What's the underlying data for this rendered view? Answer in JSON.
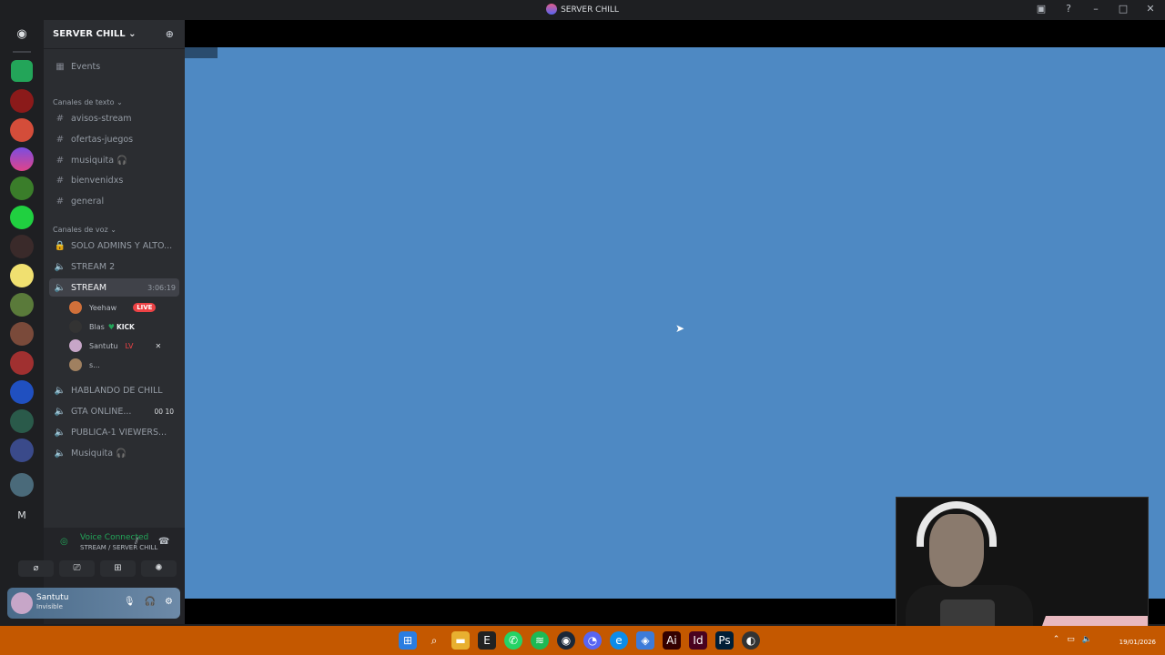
{
  "window": {
    "title": "SERVER CHILL"
  },
  "server": {
    "name": "SERVER CHILL ⌄",
    "events_label": "Events"
  },
  "categories": {
    "text": "Canales de texto ⌄",
    "voice": "Canales de voz ⌄"
  },
  "text_channels": [
    {
      "name": "avisos-stream"
    },
    {
      "name": "ofertas-juegos"
    },
    {
      "name": "musiquita 🎧"
    },
    {
      "name": "bienvenidxs"
    },
    {
      "name": "general"
    }
  ],
  "voice_channels": [
    {
      "name": "SOLO ADMINS Y ALTO...",
      "icon": "lock-icon"
    },
    {
      "name": "STREAM 2",
      "icon": "speaker-icon"
    },
    {
      "name": "STREAM",
      "icon": "speaker-icon",
      "active": true,
      "time": "3:06:19"
    },
    {
      "name": "HABLANDO DE CHILL",
      "icon": "speaker-icon"
    },
    {
      "name": "GTA ONLINE...",
      "icon": "speaker-icon",
      "count": "00  10"
    },
    {
      "name": "PUBLICA-1 VIEWERS...",
      "icon": "speaker-icon"
    },
    {
      "name": "Musiquita 🎧",
      "icon": "speaker-icon"
    }
  ],
  "voice_users": [
    {
      "name": "Yeehaw",
      "extra": "LIVE"
    },
    {
      "name": "Blas",
      "extra": "KICK"
    },
    {
      "name": "Santutu",
      "extra": "LV"
    },
    {
      "name": "s..."
    }
  ],
  "voice_panel": {
    "status": "Voice Connected",
    "location": "STREAM / SERVER CHILL"
  },
  "user": {
    "name": "Santutu",
    "status": "Invisible"
  },
  "taskbar": {
    "date": "19/01/2026"
  },
  "colors": {
    "stream_bg": "#4e89c3",
    "taskbar": "#c45800",
    "connected": "#23a559",
    "live": "#ed4245"
  }
}
